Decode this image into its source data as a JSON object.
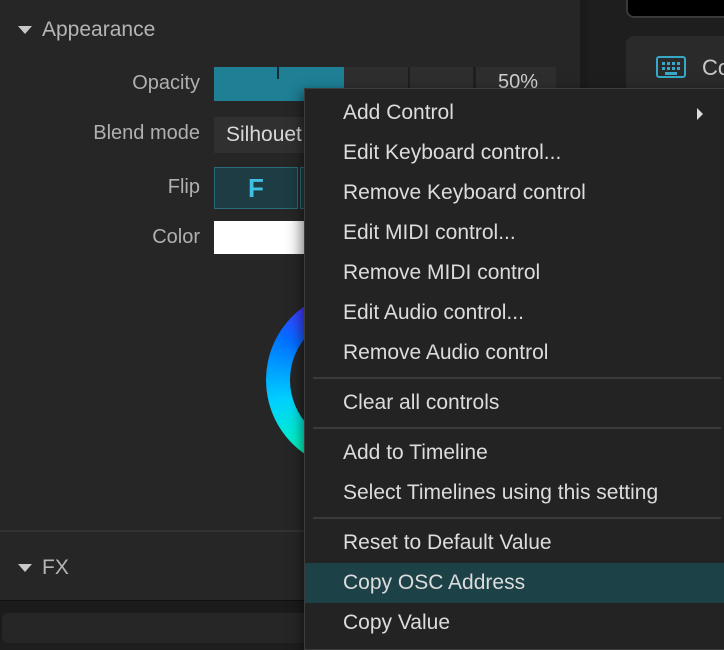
{
  "appearance": {
    "header": "Appearance",
    "opacity_label": "Opacity",
    "opacity_value": "50%",
    "opacity_fraction": 0.38,
    "blend_label": "Blend mode",
    "blend_value": "Silhouet",
    "flip_label": "Flip",
    "flip_button": "F",
    "color_label": "Color"
  },
  "fx": {
    "header": "FX"
  },
  "right_panel": {
    "card_label": "Co"
  },
  "context_menu": {
    "items": [
      {
        "label": "Add Control"
      },
      {
        "label": "Edit Keyboard control..."
      },
      {
        "label": "Remove Keyboard control"
      },
      {
        "label": "Edit MIDI control..."
      },
      {
        "label": "Remove MIDI control"
      },
      {
        "label": "Edit Audio control..."
      },
      {
        "label": "Remove Audio control"
      },
      {
        "label": "Clear all controls"
      },
      {
        "label": "Add to Timeline"
      },
      {
        "label": "Select Timelines using this setting"
      },
      {
        "label": "Reset to Default Value"
      },
      {
        "label": "Copy OSC Address"
      },
      {
        "label": "Copy Value"
      }
    ]
  },
  "colors": {
    "accent": "#1e7f95",
    "highlight": "#1c4248",
    "flip_text": "#3fc0e0"
  }
}
